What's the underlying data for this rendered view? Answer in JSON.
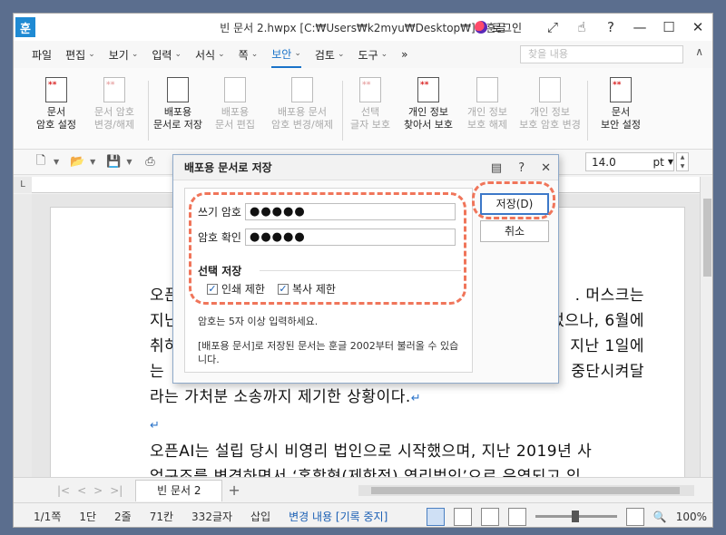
{
  "app": {
    "logo_char": "훈",
    "title": "빈 문서 2.hwpx [C:₩Users₩k2myu₩Desktop₩] - 훈글",
    "login_label": "로그인",
    "icons": [
      "expand-icon",
      "hand-icon",
      "help-icon",
      "minimize-icon",
      "maximize-icon",
      "close-icon"
    ]
  },
  "menu": {
    "items": [
      {
        "label": "파일",
        "chevron": false
      },
      {
        "label": "편집",
        "chevron": true
      },
      {
        "label": "보기",
        "chevron": true
      },
      {
        "label": "입력",
        "chevron": true
      },
      {
        "label": "서식",
        "chevron": true
      },
      {
        "label": "쪽",
        "chevron": true
      },
      {
        "label": "보안",
        "chevron": true
      },
      {
        "label": "검토",
        "chevron": true
      },
      {
        "label": "도구",
        "chevron": true
      }
    ],
    "active": "보안",
    "more_label": "»",
    "search_placeholder": "찾을 내용",
    "collapse_label": "∧"
  },
  "ribbon": {
    "doc_password": {
      "line1": "문서",
      "line2": "암호 설정"
    },
    "doc_password_change": {
      "line1": "문서 암호",
      "line2": "변경/해제"
    },
    "dist_save": {
      "line1": "배포용",
      "line2": "문서로 저장"
    },
    "dist_edit": {
      "line1": "배포용",
      "line2": "문서 편집"
    },
    "dist_password_change": {
      "line1": "배포용 문서",
      "line2": "암호 변경/해제"
    },
    "select_protect": {
      "line1": "선택",
      "line2": "글자 보호"
    },
    "personal_find": {
      "line1": "개인 정보",
      "line2": "찾아서 보호"
    },
    "personal_release": {
      "line1": "개인 정보",
      "line2": "보호 해제"
    },
    "personal_password_change": {
      "line1": "개인 정보",
      "line2": "보호 암호 변경"
    },
    "doc_security": {
      "line1": "문서",
      "line2": "보안 설정"
    },
    "asterisks": "**"
  },
  "format_toolbar": {
    "font_size": "14.0",
    "font_unit": "pt"
  },
  "document": {
    "lines": [
      "오픈AI는 설립 당시 비영리 법인으로 시작했으며 ... 머스크는",
      "지난 ... 2019년 사업구조를 ... 있었으나, 6월에",
      "취하 ... 지난 1일에",
      "는 ... 중단시켜달",
      "라는 가처분 소송까지 제기한 상황이다."
    ],
    "visible_lines": [
      {
        "left": "오픈",
        "right": ". 머스크는"
      },
      {
        "left": "지난",
        "right": "있었으나, 6월에"
      },
      {
        "left": "취하",
        "right": "지난 1일에"
      },
      {
        "left": "는",
        "right": "중단시켜달"
      }
    ],
    "line5": "라는 가처분 소송까지 제기한 상황이다.",
    "para_mark": "↵",
    "line7": "오픈AI는 설립 당시 비영리 법인으로 시작했으며, 지난 2019년 사",
    "line8": "업구조를 변경하면서 ‘혼합형(제한적) 영리법인’으로 운영되고 있"
  },
  "tabs": {
    "doc_tab": "빈 문서 2",
    "add_tab": "+"
  },
  "status": {
    "page": "1/1쪽",
    "column": "1단",
    "line": "2줄",
    "col": "71칸",
    "chars": "332글자",
    "mode": "삽입",
    "change": "변경 내용 [기록 중지]",
    "zoom": "100%"
  },
  "dialog": {
    "title": "배포용 문서로 저장",
    "write_pw_label": "쓰기 암호",
    "write_pw_value": "●●●●●",
    "confirm_pw_label": "암호 확인",
    "confirm_pw_value": "●●●●●",
    "option_group_title": "선택 저장",
    "print_limit_label": "인쇄 제한",
    "print_limit_checked": true,
    "copy_limit_label": "복사 제한",
    "copy_limit_checked": true,
    "note_min_length": "암호는 5자 이상 입력하세요.",
    "note_compat": "[배포용 문서]로 저장된 문서는 훈글 2002부터 불러올 수 있습니다.",
    "save_label": "저장(D)",
    "cancel_label": "취소"
  },
  "colors": {
    "accent": "#1a73c9",
    "highlight": "#f0755a",
    "asterisk": "#d92020"
  }
}
